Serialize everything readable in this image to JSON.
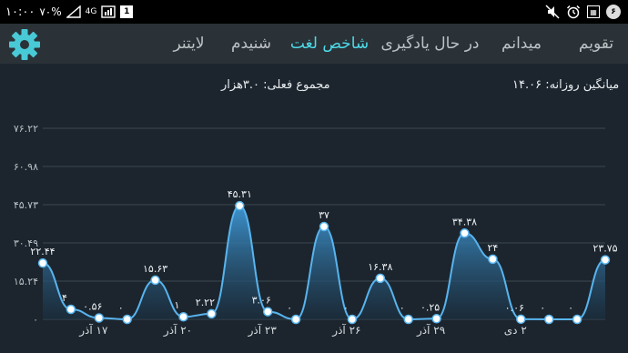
{
  "status_bar": {
    "time": "۱۰:۰۰",
    "battery": "٧٠%",
    "network": "4G",
    "left_icons": [
      "alarm-icon",
      "mute-icon"
    ],
    "right_icons": [
      "battery-icon",
      "signal-icon",
      "wifi-icon",
      "sim-icon",
      "notification-icon"
    ],
    "badge_1": "1",
    "badge_2": "۶"
  },
  "tabs": [
    {
      "label": "تقویم",
      "active": false
    },
    {
      "label": "میدانم",
      "active": false
    },
    {
      "label": "در حال یادگیری",
      "active": false
    },
    {
      "label": "شاخص لغت",
      "active": true
    },
    {
      "label": "شنیدم",
      "active": false
    },
    {
      "label": "لایتنر",
      "active": false
    }
  ],
  "settings_icon": "gear-icon",
  "colors": {
    "accent": "#4ddbe8",
    "topbar": "#2a3238",
    "background": "#1c252e",
    "line": "#58b4ee"
  },
  "header": {
    "daily_average": "میانگین روزانه: ۱۴.۰۶",
    "total_current": "مجموع فعلی: ۳.۰هزار"
  },
  "chart_data": {
    "type": "area",
    "y_ticks": [
      "۰",
      "۱۵.۲۴",
      "۳۰.۴۹",
      "۴۵.۷۳",
      "۶۰.۹۸",
      "۷۶.۲۲"
    ],
    "ylim": [
      0,
      76.22
    ],
    "x_labels": [
      {
        "index": 2,
        "label": "۱۷ آذر"
      },
      {
        "index": 5,
        "label": "۲۰ آذر"
      },
      {
        "index": 8,
        "label": "۲۳ آذر"
      },
      {
        "index": 11,
        "label": "۲۶ آذر"
      },
      {
        "index": 14,
        "label": "۲۹ آذر"
      },
      {
        "index": 17,
        "label": "۲ دی"
      }
    ],
    "values": [
      22.44,
      4,
      0.56,
      0,
      15.63,
      1,
      2.22,
      45.31,
      3.06,
      0,
      37,
      0,
      16.38,
      0,
      0.25,
      34.38,
      24,
      0.06,
      0,
      0,
      23.75
    ],
    "labels": [
      "۲۲.۴۴",
      "۴",
      "۰.۵۶",
      "۰",
      "۱۵.۶۳",
      "۱",
      "۲.۲۲",
      "۴۵.۳۱",
      "۳.۰۶",
      "۰",
      "۳۷",
      "۰",
      "۱۶.۳۸",
      "۰",
      "۰.۲۵",
      "۳۴.۳۸",
      "۲۴",
      "۰.۰۶",
      "۰",
      "۰",
      "۲۳.۷۵"
    ]
  }
}
